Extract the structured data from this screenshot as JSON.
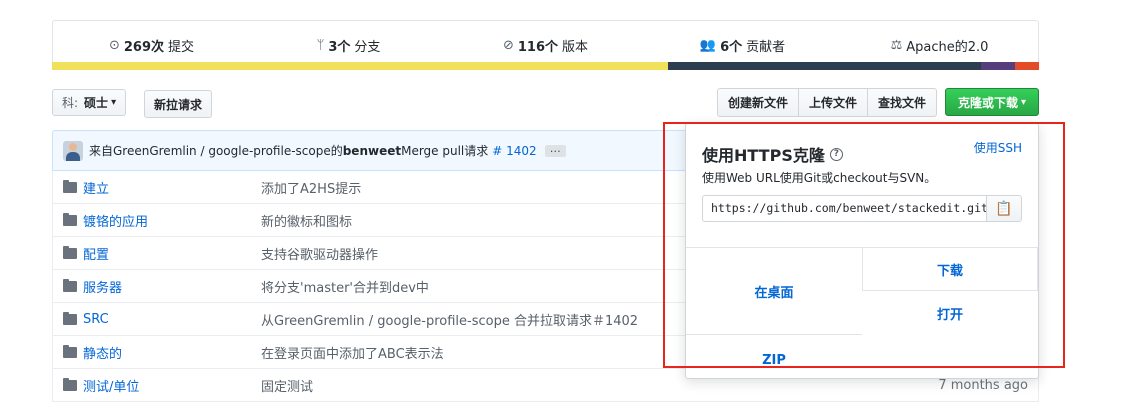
{
  "stats": [
    {
      "icon": "commit-icon",
      "glyph": "⊙",
      "count": "269次",
      "label": "提交"
    },
    {
      "icon": "branch-icon",
      "glyph": "ᛘ",
      "count": "3个",
      "label": "分支"
    },
    {
      "icon": "tag-icon",
      "glyph": "⊘",
      "count": "116个",
      "label": "版本"
    },
    {
      "icon": "contributors-icon",
      "glyph": "👥",
      "count": "6个",
      "label": "贡献者"
    },
    {
      "icon": "license-icon",
      "glyph": "⚖",
      "count": "",
      "label": "Apache的2.0"
    }
  ],
  "language_bar_colors": [
    "#f1e05a",
    "#2b3d4f",
    "#563d7c",
    "#e34c26"
  ],
  "branch": {
    "key": "科:",
    "value": "硕士",
    "caret": "▾"
  },
  "new_pr_label": "新拉请求",
  "actions": {
    "create": "创建新文件",
    "upload": "上传文件",
    "find": "查找文件",
    "clone": "克隆或下载",
    "clone_caret": "▾"
  },
  "commit": {
    "prefix": "来自GreenGremlin / google-profile-scope的",
    "author": "benweet",
    "message": " Merge pull请求",
    "pr": "# 1402",
    "ellipsis": "…"
  },
  "files": [
    {
      "name": "建立",
      "message": "添加了A2HS提示",
      "age": ""
    },
    {
      "name": "镀铬的应用",
      "message": "新的徽标和图标",
      "age": ""
    },
    {
      "name": "配置",
      "message": "支持谷歌驱动器操作",
      "age": ""
    },
    {
      "name": "服务器",
      "message": "将分支'master'合并到dev中",
      "age": ""
    },
    {
      "name": "SRC",
      "message": "从GreenGremlin / google-profile-scope 合并拉取请求＃1402",
      "age": ""
    },
    {
      "name": "静态的",
      "message": "在登录页面中添加了ABC表示法",
      "age": ""
    },
    {
      "name": "测试/单位",
      "message": "固定测试",
      "age": "7 months ago"
    }
  ],
  "clone_popup": {
    "title": "使用HTTPS克隆",
    "help_glyph": "?",
    "ssh_link": "使用SSH",
    "description": "使用Web URL使用Git或checkout与SVN。",
    "url": "https://github.com/benweet/stackedit.git",
    "copy_glyph": "📋",
    "open_desktop": "在桌面",
    "download": "下载",
    "open": "打开",
    "zip": "ZIP"
  },
  "colors": {
    "link": "#0366d6",
    "highlight": "#e8241f",
    "clone_green": "#28a745"
  }
}
